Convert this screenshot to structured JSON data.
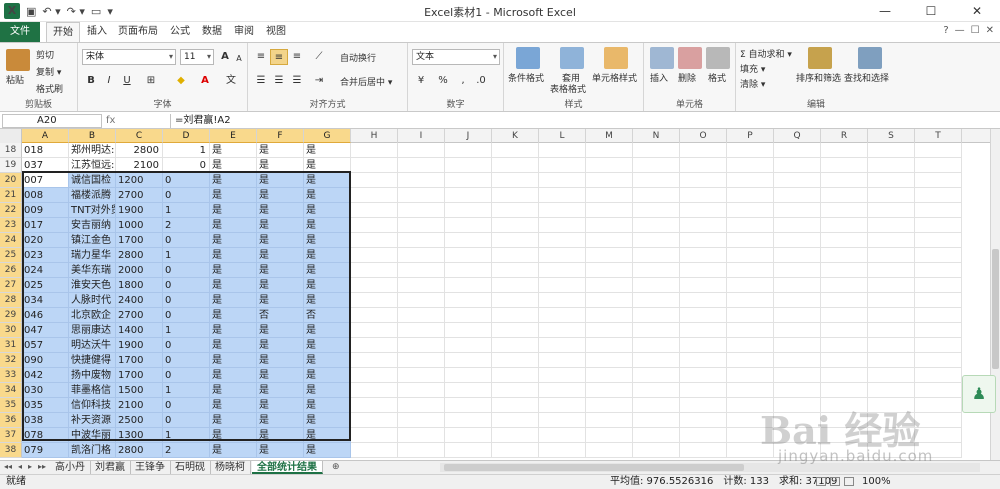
{
  "window": {
    "title": "Excel素材1 - Microsoft Excel",
    "buttons": [
      "—",
      "☐",
      "✕"
    ],
    "help_icons": [
      "?",
      "—",
      "☐",
      "✕"
    ]
  },
  "tabs": {
    "file": "文件",
    "items": [
      "开始",
      "插入",
      "页面布局",
      "公式",
      "数据",
      "审阅",
      "视图"
    ]
  },
  "ribbon": {
    "clipboard": {
      "paste": "粘贴",
      "cut": "剪切",
      "copy": "复制 ▾",
      "format_painter": "格式刷",
      "label": "剪贴板"
    },
    "font": {
      "name": "宋体",
      "size": "11",
      "bold": "B",
      "italic": "I",
      "underline": "U",
      "grow": "A",
      "shrink": "A",
      "label": "字体"
    },
    "alignment": {
      "wrap": "自动换行",
      "merge": "合并后居中 ▾",
      "label": "对齐方式"
    },
    "number": {
      "format": "文本",
      "percent": "%",
      "comma": "‚",
      "currency": "¥",
      "label": "数字"
    },
    "styles": {
      "conditional": "条件格式",
      "table": "套用",
      "table2": "表格格式",
      "cell_styles": "单元格样式",
      "label": "样式"
    },
    "cells": {
      "insert": "插入",
      "delete": "删除",
      "format": "格式",
      "label": "单元格"
    },
    "editing": {
      "autosum": "Σ 自动求和 ▾",
      "fill": "填充 ▾",
      "clear": "清除 ▾",
      "sort": "排序和筛选",
      "find": "查找和选择",
      "label": "编辑"
    }
  },
  "formula_bar": {
    "namebox": "A20",
    "fx": "fx",
    "formula": "=刘君赢!A2"
  },
  "columns": [
    "A",
    "B",
    "C",
    "D",
    "E",
    "F",
    "G",
    "H",
    "I",
    "J",
    "K",
    "L",
    "M",
    "N",
    "O",
    "P",
    "Q",
    "R",
    "S",
    "T"
  ],
  "rows": [
    {
      "n": "18",
      "a": "018",
      "b": "郑州明达:",
      "c": "2800",
      "d": "1",
      "e": "是",
      "f": "是",
      "g": "是",
      "num": true
    },
    {
      "n": "19",
      "a": "037",
      "b": "江苏恒远:",
      "c": "2100",
      "d": "0",
      "e": "是",
      "f": "是",
      "g": "是",
      "num": true
    },
    {
      "n": "20",
      "a": "007",
      "b": "诚信国检",
      "c": "1200",
      "d": "0",
      "e": "是",
      "f": "是",
      "g": "是"
    },
    {
      "n": "21",
      "a": "008",
      "b": "福楼派腾",
      "c": "2700",
      "d": "0",
      "e": "是",
      "f": "是",
      "g": "是"
    },
    {
      "n": "22",
      "a": "009",
      "b": "TNT对外贸",
      "c": "1900",
      "d": "1",
      "e": "是",
      "f": "是",
      "g": "是"
    },
    {
      "n": "23",
      "a": "017",
      "b": "安吉丽纳",
      "c": "1000",
      "d": "2",
      "e": "是",
      "f": "是",
      "g": "是"
    },
    {
      "n": "24",
      "a": "020",
      "b": "镇江金色",
      "c": "1700",
      "d": "0",
      "e": "是",
      "f": "是",
      "g": "是"
    },
    {
      "n": "25",
      "a": "023",
      "b": "瑞力星华",
      "c": "2800",
      "d": "1",
      "e": "是",
      "f": "是",
      "g": "是"
    },
    {
      "n": "26",
      "a": "024",
      "b": "美华东瑞",
      "c": "2000",
      "d": "0",
      "e": "是",
      "f": "是",
      "g": "是"
    },
    {
      "n": "27",
      "a": "025",
      "b": "淮安天色",
      "c": "1800",
      "d": "0",
      "e": "是",
      "f": "是",
      "g": "是"
    },
    {
      "n": "28",
      "a": "034",
      "b": "人脉时代",
      "c": "2400",
      "d": "0",
      "e": "是",
      "f": "是",
      "g": "是"
    },
    {
      "n": "29",
      "a": "046",
      "b": "北京欧企",
      "c": "2700",
      "d": "0",
      "e": "是",
      "f": "否",
      "g": "否"
    },
    {
      "n": "30",
      "a": "047",
      "b": "思丽康达",
      "c": "1400",
      "d": "1",
      "e": "是",
      "f": "是",
      "g": "是"
    },
    {
      "n": "31",
      "a": "057",
      "b": "明达沃牛",
      "c": "1900",
      "d": "0",
      "e": "是",
      "f": "是",
      "g": "是"
    },
    {
      "n": "32",
      "a": "090",
      "b": "快捷健得",
      "c": "1700",
      "d": "0",
      "e": "是",
      "f": "是",
      "g": "是"
    },
    {
      "n": "33",
      "a": "042",
      "b": "扬中废物",
      "c": "1700",
      "d": "0",
      "e": "是",
      "f": "是",
      "g": "是"
    },
    {
      "n": "34",
      "a": "030",
      "b": "菲墨格信",
      "c": "1500",
      "d": "1",
      "e": "是",
      "f": "是",
      "g": "是"
    },
    {
      "n": "35",
      "a": "035",
      "b": "信仰科技",
      "c": "2100",
      "d": "0",
      "e": "是",
      "f": "是",
      "g": "是"
    },
    {
      "n": "36",
      "a": "038",
      "b": "补天资源",
      "c": "2500",
      "d": "0",
      "e": "是",
      "f": "是",
      "g": "是"
    },
    {
      "n": "37",
      "a": "078",
      "b": "中波华丽",
      "c": "1300",
      "d": "1",
      "e": "是",
      "f": "是",
      "g": "是"
    },
    {
      "n": "38",
      "a": "079",
      "b": "凯洛门格",
      "c": "2800",
      "d": "2",
      "e": "是",
      "f": "是",
      "g": "是"
    }
  ],
  "sheets": [
    "高小丹",
    "刘君赢",
    "王锋争",
    "石明砚",
    "杨晓柯",
    "全部统计结果"
  ],
  "status": {
    "ready": "就绪",
    "average": "平均值: 976.5526316",
    "count": "计数: 133",
    "sum": "求和: 37109",
    "zoom": "100%"
  },
  "watermark": {
    "logo": "Bai 经验",
    "url": "jingyan.baidu.com"
  },
  "colors": {
    "excel_green": "#1e7145",
    "selection": "#bcd6f6",
    "header_selected": "#f9d98c"
  }
}
